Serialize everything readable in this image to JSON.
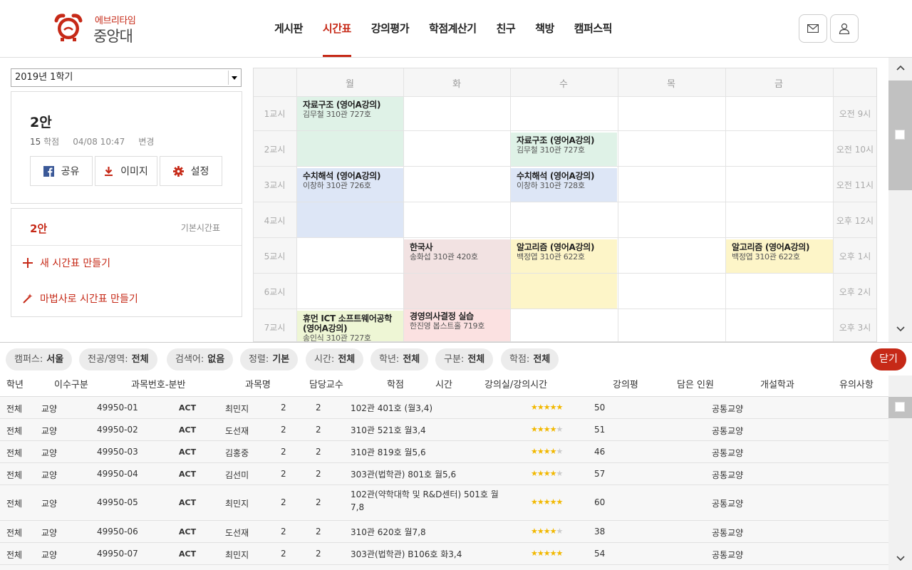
{
  "header": {
    "brand_sub": "에브리타임",
    "brand_main": "중앙대",
    "nav": [
      "게시판",
      "시간표",
      "강의평가",
      "학점계산기",
      "친구",
      "책방",
      "캠퍼스픽"
    ],
    "active_nav": "시간표",
    "accent_color": "#c62917"
  },
  "left": {
    "semester": "2019년 1학기",
    "plan_title": "2안",
    "credits": "15",
    "credits_unit": "학점",
    "updated": "04/08 10:47",
    "changed": "변경",
    "share": "공유",
    "image": "이미지",
    "settings": "설정",
    "current_plan": "2안",
    "default_label": "기본시간표",
    "new_table": "새 시간표 만들기",
    "wizard": "마법사로 시간표 만들기"
  },
  "timetable": {
    "days": [
      "월",
      "화",
      "수",
      "목",
      "금"
    ],
    "periods": [
      "1교시",
      "2교시",
      "3교시",
      "4교시",
      "5교시",
      "6교시",
      "7교시"
    ],
    "times": [
      "오전 9시",
      "오전 10시",
      "오전 11시",
      "오후 12시",
      "오후 1시",
      "오후 2시",
      "오후 3시"
    ],
    "courses": [
      {
        "name": "자료구조 (영어A강의)",
        "info": "김무철  310관 727호",
        "color": "#dff2e7"
      },
      {
        "name": "자료구조 (영어A강의)",
        "info": "김무철  310관 727호",
        "color": "#dff2e7"
      },
      {
        "name": "수치해석 (영어A강의)",
        "info": "이창하  310관 726호",
        "color": "#dde6f6"
      },
      {
        "name": "수치해석 (영어A강의)",
        "info": "이창하  310관 728호",
        "color": "#dde6f6"
      },
      {
        "name": "한국사",
        "info": "송화섭  310관 420호",
        "color": "#f2e2e2"
      },
      {
        "name": "알고리즘 (영어A강의)",
        "info": "백정엽  310관 622호",
        "color": "#fdf5c8"
      },
      {
        "name": "알고리즘 (영어A강의)",
        "info": "백정엽  310관 622호",
        "color": "#fdf5c8"
      },
      {
        "name": "휴먼 ICT 소프트웨어공학 (영어A강의)",
        "info": "송인식  310관 727호",
        "color": "#eef6d5"
      },
      {
        "name": "경영의사결정 실습",
        "info": "한진영  봅스트홀 719호",
        "color": "#fbe1e1"
      }
    ]
  },
  "filters": [
    {
      "label": "캠퍼스:",
      "value": "서울"
    },
    {
      "label": "전공/영역:",
      "value": "전체"
    },
    {
      "label": "검색어:",
      "value": "없음"
    },
    {
      "label": "정렬:",
      "value": "기본"
    },
    {
      "label": "시간:",
      "value": "전체"
    },
    {
      "label": "학년:",
      "value": "전체"
    },
    {
      "label": "구분:",
      "value": "전체"
    },
    {
      "label": "학점:",
      "value": "전체"
    }
  ],
  "close_label": "닫기",
  "list": {
    "headers": [
      "학년",
      "이수구분",
      "과목번호-분반",
      "과목명",
      "담당교수",
      "학점",
      "시간",
      "강의실/강의시간",
      "강의평",
      "담은 인원",
      "개설학과",
      "유의사항"
    ],
    "rows": [
      {
        "grade": "전체",
        "type": "교양",
        "code": "49950-01",
        "name": "ACT",
        "prof": "최민지",
        "credit": "2",
        "hours": "2",
        "room": "102관 401호 (월3,4)",
        "rating": 4.5,
        "count": "50",
        "dept": "공통교양"
      },
      {
        "grade": "전체",
        "type": "교양",
        "code": "49950-02",
        "name": "ACT",
        "prof": "도선재",
        "credit": "2",
        "hours": "2",
        "room": "310관 521호 월3,4",
        "rating": 3.5,
        "count": "51",
        "dept": "공통교양"
      },
      {
        "grade": "전체",
        "type": "교양",
        "code": "49950-03",
        "name": "ACT",
        "prof": "김홍중",
        "credit": "2",
        "hours": "2",
        "room": "310관 819호 월5,6",
        "rating": 4.0,
        "count": "46",
        "dept": "공통교양"
      },
      {
        "grade": "전체",
        "type": "교양",
        "code": "49950-04",
        "name": "ACT",
        "prof": "김선미",
        "credit": "2",
        "hours": "2",
        "room": "303관(법학관) 801호 월5,6",
        "rating": 4.0,
        "count": "57",
        "dept": "공통교양"
      },
      {
        "grade": "전체",
        "type": "교양",
        "code": "49950-05",
        "name": "ACT",
        "prof": "최민지",
        "credit": "2",
        "hours": "2",
        "room": "102관(약학대학 및 R&D센터) 501호 월 7,8",
        "rating": 4.5,
        "count": "60",
        "dept": "공통교양"
      },
      {
        "grade": "전체",
        "type": "교양",
        "code": "49950-06",
        "name": "ACT",
        "prof": "도선재",
        "credit": "2",
        "hours": "2",
        "room": "310관 620호 월7,8",
        "rating": 3.5,
        "count": "38",
        "dept": "공통교양"
      },
      {
        "grade": "전체",
        "type": "교양",
        "code": "49950-07",
        "name": "ACT",
        "prof": "최민지",
        "credit": "2",
        "hours": "2",
        "room": "303관(법학관) B106호 화3,4",
        "rating": 4.5,
        "count": "54",
        "dept": "공통교양"
      }
    ]
  }
}
